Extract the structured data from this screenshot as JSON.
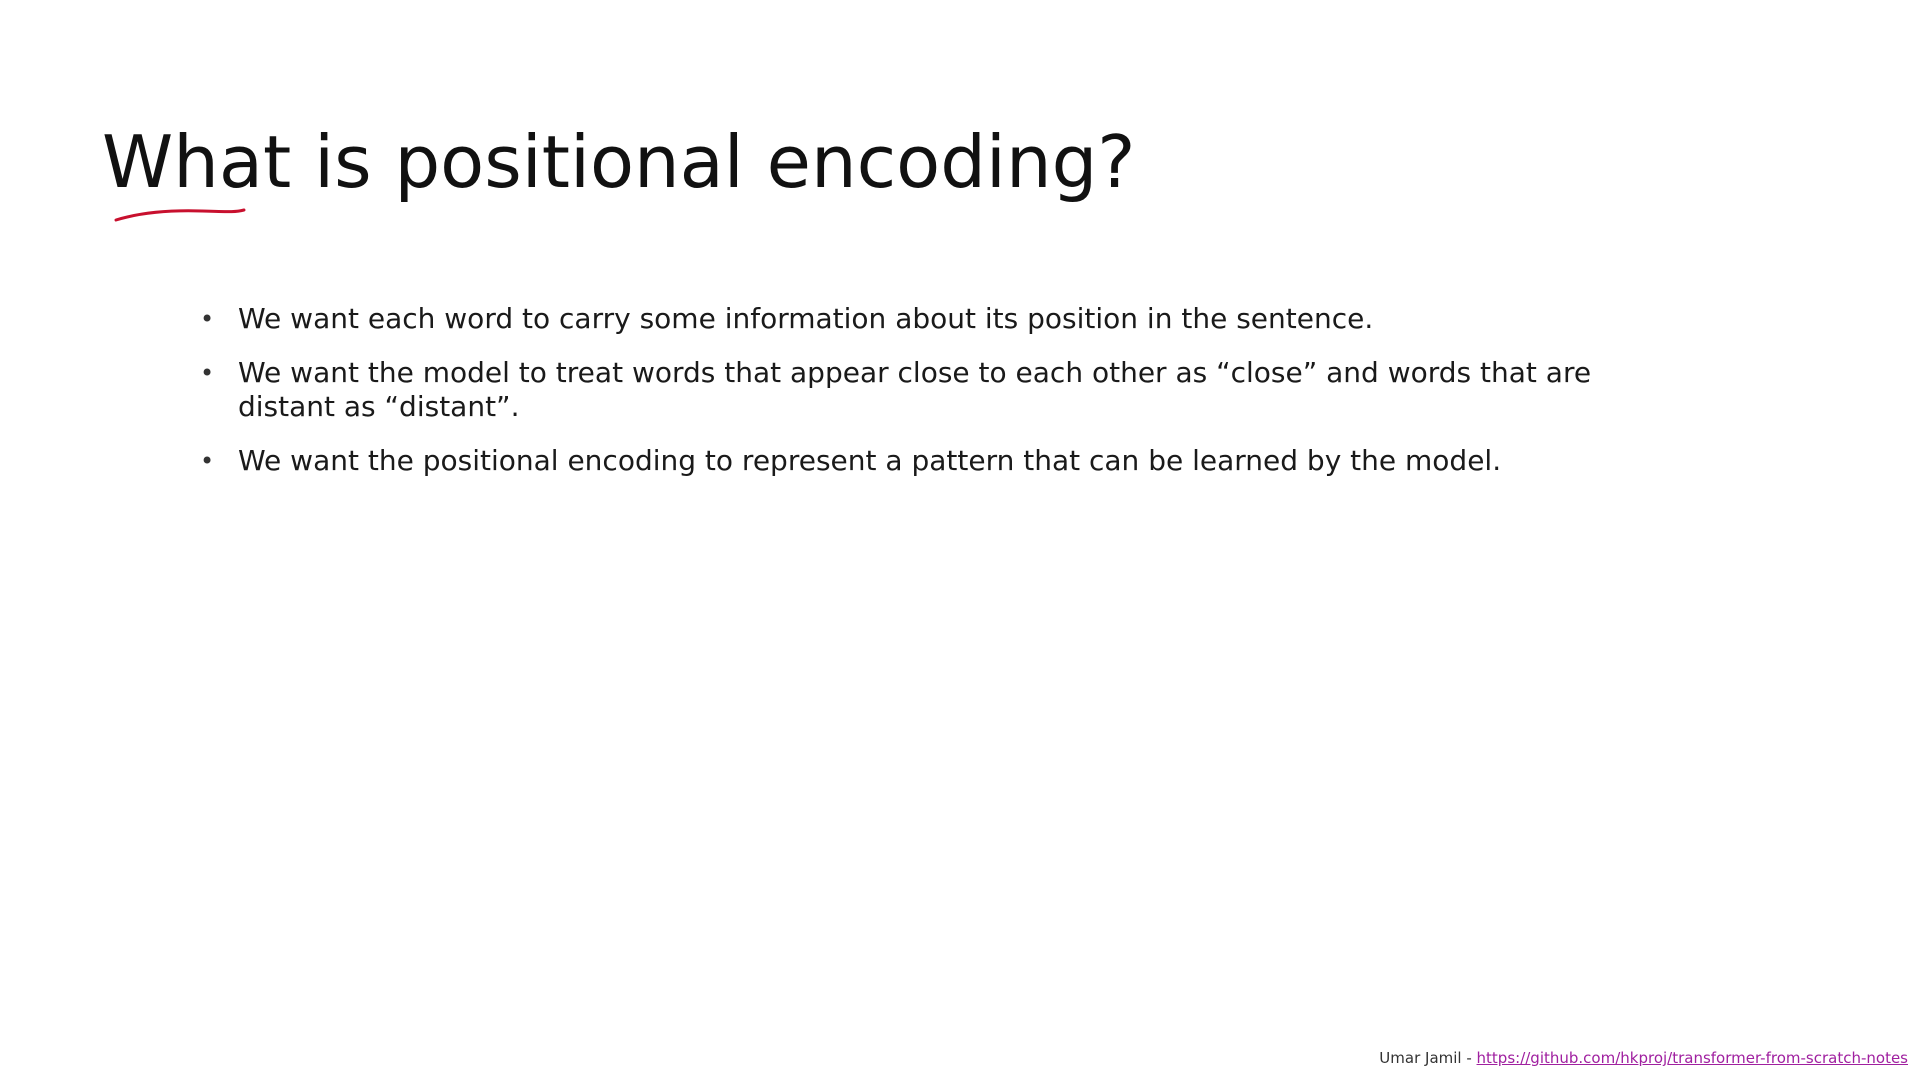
{
  "slide": {
    "title": "What is positional encoding?",
    "bullet_glyph": "•",
    "bullets": [
      "We want each word to carry some information about its position in the sentence.",
      "We want the model to treat words that appear close to each other as “close” and words that are distant as “distant”.",
      "We want the positional encoding to represent a pattern that can be learned by the model."
    ],
    "annotation_color": "#c8102e"
  },
  "footer": {
    "author": "Umar Jamil - ",
    "link_text": "https://github.com/hkproj/transformer-from-scratch-notes",
    "link_color": "#a020a0"
  }
}
